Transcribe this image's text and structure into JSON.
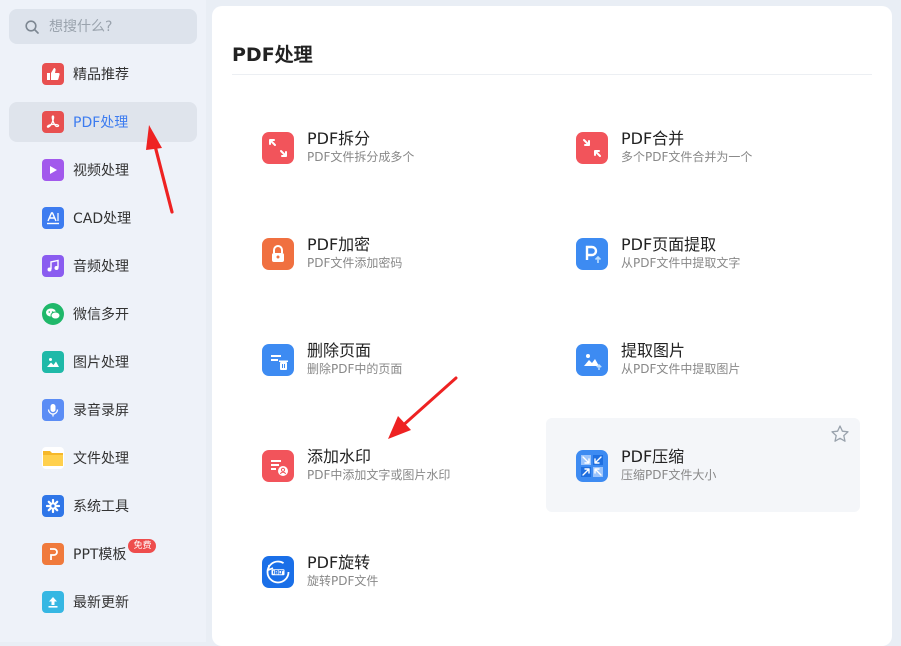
{
  "search": {
    "placeholder": "想搜什么?"
  },
  "sidebar": {
    "items": [
      {
        "label": "精品推荐",
        "icon": "thumbs-up-icon",
        "color": "#e85050"
      },
      {
        "label": "PDF处理",
        "icon": "pdf-icon",
        "color": "#e85050",
        "active": true
      },
      {
        "label": "视频处理",
        "icon": "play-icon",
        "color": "#a259ec"
      },
      {
        "label": "CAD处理",
        "icon": "cad-icon",
        "color": "#3d7cf0"
      },
      {
        "label": "音频处理",
        "icon": "music-icon",
        "color": "#8a5cf0"
      },
      {
        "label": "微信多开",
        "icon": "wechat-icon",
        "color": "#1fb86a"
      },
      {
        "label": "图片处理",
        "icon": "image-icon",
        "color": "#1fb9a8"
      },
      {
        "label": "录音录屏",
        "icon": "microphone-icon",
        "color": "#5b8df5"
      },
      {
        "label": "文件处理",
        "icon": "folder-icon",
        "color": "#f6b82a"
      },
      {
        "label": "系统工具",
        "icon": "gear-icon",
        "color": "#2f76e8"
      },
      {
        "label": "PPT模板",
        "icon": "ppt-icon",
        "color": "#f07a3c",
        "badge": "免费"
      },
      {
        "label": "最新更新",
        "icon": "upload-icon",
        "color": "#36b7e3"
      }
    ]
  },
  "main": {
    "title": "PDF处理",
    "tools": [
      {
        "name": "PDF拆分",
        "desc": "PDF文件拆分成多个",
        "icon": "split-icon",
        "color": "#f2545b"
      },
      {
        "name": "PDF合并",
        "desc": "多个PDF文件合并为一个",
        "icon": "merge-icon",
        "color": "#f2545b"
      },
      {
        "name": "PDF加密",
        "desc": "PDF文件添加密码",
        "icon": "lock-icon",
        "color": "#f07040"
      },
      {
        "name": "PDF页面提取",
        "desc": "从PDF文件中提取文字",
        "icon": "page-extract-icon",
        "color": "#3d8bf2"
      },
      {
        "name": "删除页面",
        "desc": "删除PDF中的页面",
        "icon": "delete-page-icon",
        "color": "#3d8bf2"
      },
      {
        "name": "提取图片",
        "desc": "从PDF文件中提取图片",
        "icon": "extract-image-icon",
        "color": "#3d8bf2"
      },
      {
        "name": "添加水印",
        "desc": "PDF中添加文字或图片水印",
        "icon": "watermark-icon",
        "color": "#f2545b"
      },
      {
        "name": "PDF压缩",
        "desc": "压缩PDF文件大小",
        "icon": "compress-icon",
        "color": "#3d8bf2"
      },
      {
        "name": "PDF旋转",
        "desc": "旋转PDF文件",
        "icon": "rotate-icon",
        "color": "#1a6fe8"
      }
    ]
  },
  "colors": {
    "accent": "#3d7cf0",
    "arrow": "#ee2222"
  }
}
